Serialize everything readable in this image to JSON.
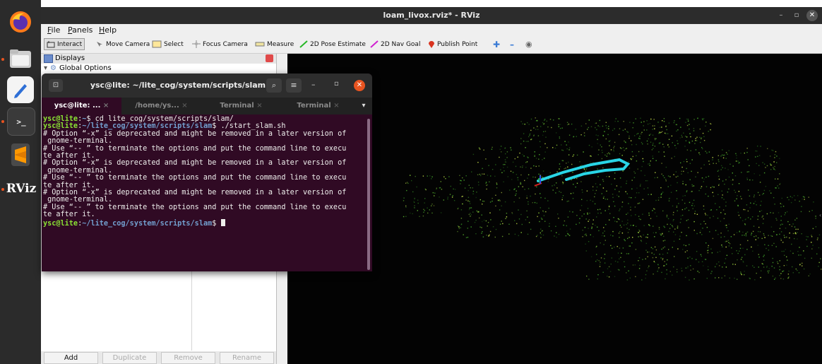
{
  "dock": {
    "items": [
      "firefox-icon",
      "files-icon",
      "text-editor-icon",
      "terminal-icon",
      "sublime-text-icon",
      "rviz-icon"
    ],
    "rviz_label": "RViz"
  },
  "window": {
    "title": "loam_livox.rviz* - RViz"
  },
  "menu": {
    "file": "File",
    "panels": "Panels",
    "help": "Help"
  },
  "toolbar": {
    "interact": "Interact",
    "move_camera": "Move Camera",
    "select": "Select",
    "focus_camera": "Focus Camera",
    "measure": "Measure",
    "pose_estimate": "2D Pose Estimate",
    "nav_goal": "2D Nav Goal",
    "publish_point": "Publish Point"
  },
  "displays_panel": {
    "title": "Displays",
    "global_options": "Global Options",
    "buttons": {
      "add": "Add",
      "duplicate": "Duplicate",
      "remove": "Remove",
      "rename": "Rename"
    }
  },
  "terminal": {
    "title": "ysc@lite: ~/lite_cog/system/scripts/slam",
    "tabs": [
      "ysc@lite: ...",
      "/home/ys...",
      "Terminal",
      "Terminal"
    ],
    "prompt_user": "ysc@lite",
    "prompt_path_home": "~",
    "prompt_path_slam": "~/lite_cog/system/scripts/slam",
    "cmd1": " cd lite_cog/system/scripts/slam/",
    "cmd2": " ./start_slam.sh",
    "output": [
      "# Option “-x” is deprecated and might be removed in a later version of",
      " gnome-terminal.",
      "# Use “-- ” to terminate the options and put the command line to execu",
      "te after it.",
      "# Option “-x” is deprecated and might be removed in a later version of",
      " gnome-terminal.",
      "# Use “-- ” to terminate the options and put the command line to execu",
      "te after it.",
      "# Option “-x” is deprecated and might be removed in a later version of",
      " gnome-terminal.",
      "# Use “-- ” to terminate the options and put the command line to execu",
      "te after it."
    ]
  },
  "colors": {
    "terminal_bg": "#300a24",
    "prompt_green": "#8ae234",
    "prompt_blue": "#729fcf",
    "trajectory": "#29d5e6",
    "dock_accent": "#e95420"
  }
}
